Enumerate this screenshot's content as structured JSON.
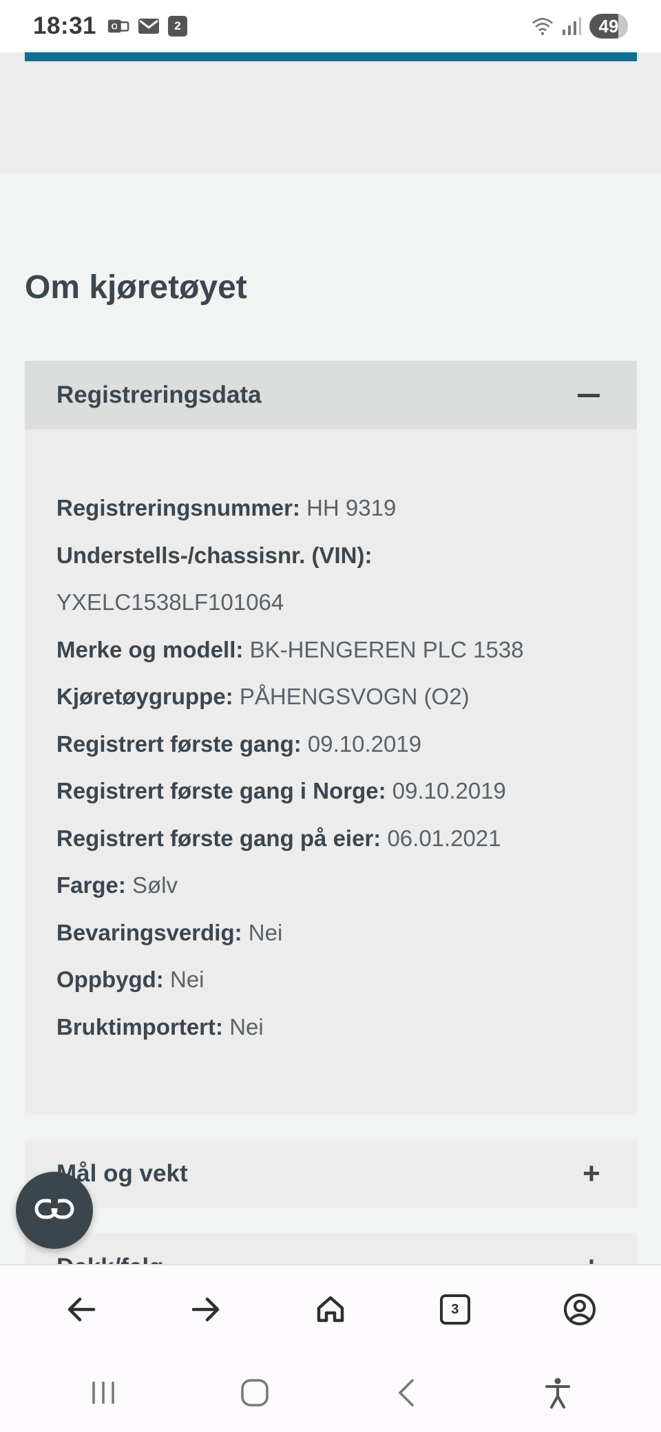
{
  "status_bar": {
    "time": "18:31",
    "calendar_badge": "2",
    "battery": "49"
  },
  "page": {
    "section_title": "Om kjøretøyet"
  },
  "accordions": [
    {
      "title": "Registreringsdata",
      "expanded": true,
      "rows": [
        {
          "label": "Registreringsnummer:",
          "value": "HH 9319"
        },
        {
          "label": "Understells-/chassisnr. (VIN):",
          "value": ""
        },
        {
          "label": "",
          "value": "YXELC1538LF101064"
        },
        {
          "label": "Merke og modell:",
          "value": "BK-HENGEREN PLC 1538"
        },
        {
          "label": "Kjøretøygruppe:",
          "value": "PÅHENGSVOGN (O2)"
        },
        {
          "label": "Registrert første gang:",
          "value": "09.10.2019"
        },
        {
          "label": "Registrert første gang i Norge:",
          "value": "09.10.2019"
        },
        {
          "label": "Registrert første gang på eier:",
          "value": "06.01.2021"
        },
        {
          "label": "Farge:",
          "value": "Sølv"
        },
        {
          "label": "Bevaringsverdig:",
          "value": "Nei"
        },
        {
          "label": "Oppbygd:",
          "value": "Nei"
        },
        {
          "label": "Bruktimportert:",
          "value": "Nei"
        }
      ]
    },
    {
      "title": "Mål og vekt",
      "expanded": false,
      "toggle": "+"
    },
    {
      "title": "Dekk/felg",
      "expanded": false,
      "toggle": "+"
    }
  ],
  "browser_bar": {
    "tab_count": "3"
  },
  "colors": {
    "accent_blue": "#0d6f93",
    "text_dark": "#3c4650",
    "panel_bg": "#ebeceb",
    "header_bg": "#dcdddd"
  },
  "icons": {
    "status": [
      "outlook-icon",
      "mail-icon",
      "calendar-icon",
      "wifi-icon",
      "signal-icon"
    ],
    "browser": [
      "back-arrow-icon",
      "forward-arrow-icon",
      "home-icon",
      "tabs-icon",
      "account-icon"
    ],
    "system": [
      "recent-apps-icon",
      "home-circle-icon",
      "back-chevron-icon",
      "accessibility-icon"
    ],
    "fab": "link-icon"
  }
}
